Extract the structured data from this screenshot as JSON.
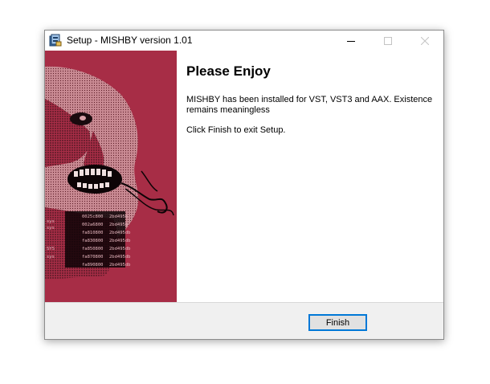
{
  "window": {
    "title": "Setup - MISHBY version 1.01",
    "app_icon": "installer-icon",
    "controls": [
      "minimize-icon",
      "maximize-icon",
      "close-icon"
    ]
  },
  "main": {
    "heading": "Please Enjoy",
    "message": "MISHBY has been installed for VST, VST3 and AAX. Existence remains meaningless",
    "instruction": "Click Finish to exit Setup."
  },
  "side_image": {
    "description_icon": "artwork-face-illustration",
    "hex_rows": [
      {
        "label": "sys",
        "a": "0025c800",
        "b": "2bd495b"
      },
      {
        "label": "sys",
        "a": "002a6800",
        "b": "2bd495b"
      },
      {
        "label": "",
        "a": "fa810800",
        "b": "2bd495db"
      },
      {
        "label": "",
        "a": "fa830800",
        "b": "2bd495db"
      },
      {
        "label": "SYS",
        "a": "fa850800",
        "b": "2bd495db"
      },
      {
        "label": "sys",
        "a": "fa870800",
        "b": "2bd495db"
      },
      {
        "label": "",
        "a": "fa890800",
        "b": "2bd495db"
      }
    ]
  },
  "footer": {
    "finish_label": "Finish"
  },
  "colors": {
    "side_bg": "#a72d46",
    "focus_border": "#0078d7",
    "footer_bg": "#f0f0f0"
  }
}
